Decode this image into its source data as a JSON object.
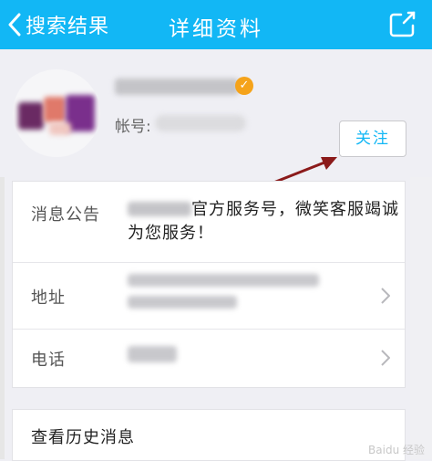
{
  "nav": {
    "back_label": "搜索结果",
    "title": "详细资料",
    "accent": "#12b7f5"
  },
  "profile": {
    "account_label": "帐号:",
    "follow_label": "关注",
    "verified_icon": "check-badge-icon"
  },
  "details": {
    "notice_label": "消息公告",
    "notice_text": "官方服务号，微笑客服竭诚为您服务！",
    "address_label": "地址",
    "phone_label": "电话"
  },
  "history": {
    "label": "查看历史消息"
  },
  "watermark": "Baidu 经验"
}
